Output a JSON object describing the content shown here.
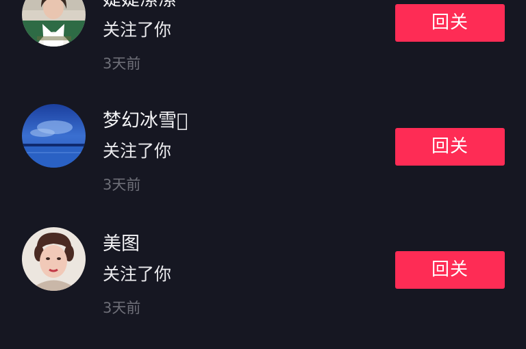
{
  "followers": [
    {
      "name": "婕婕潆潆",
      "action": "关注了你",
      "time": "3天前",
      "button": "回关",
      "avatar": "avatar-girl-green-jacket"
    },
    {
      "name": "梦幻冰雪\u0000",
      "action": "关注了你",
      "time": "3天前",
      "button": "回关",
      "avatar": "avatar-blue-sky-sea"
    },
    {
      "name": "美图",
      "action": "关注了你",
      "time": "3天前",
      "button": "回关",
      "avatar": "avatar-woman-portrait"
    }
  ],
  "colors": {
    "background": "#161722",
    "accent": "#fe2c55",
    "secondary_text": "#6e6f78"
  }
}
